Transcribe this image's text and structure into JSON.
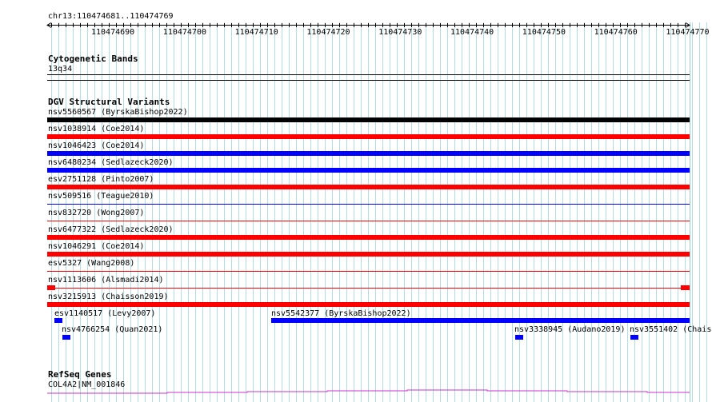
{
  "ruler": {
    "location": "chr13:110474681..110474769",
    "ticks": [
      "110474690",
      "110474700",
      "110474710",
      "110474720",
      "110474730",
      "110474740",
      "110474750",
      "110474760",
      "110474770"
    ]
  },
  "cytobands": {
    "title": "Cytogenetic Bands",
    "band": "13q34"
  },
  "dgv": {
    "title": "DGV Structural Variants",
    "colors": {
      "black": "#000000",
      "red": "#ff0000",
      "blue": "#0000ff"
    },
    "rows": [
      {
        "label": "nsv5560567 (ByrskaBishop2022)",
        "color": "black",
        "style": "full"
      },
      {
        "label": "nsv1038914 (Coe2014)",
        "color": "red",
        "style": "full"
      },
      {
        "label": "nsv1046423 (Coe2014)",
        "color": "blue",
        "style": "full"
      },
      {
        "label": "nsv6480234 (Sedlazeck2020)",
        "color": "blue",
        "style": "full"
      },
      {
        "label": "esv2751128 (Pinto2007)",
        "color": "red",
        "style": "full"
      },
      {
        "label": "nsv509516 (Teague2010)",
        "color": "blue",
        "style": "thin"
      },
      {
        "label": "nsv832720 (Wong2007)",
        "color": "red",
        "style": "thin"
      },
      {
        "label": "nsv6477322 (Sedlazeck2020)",
        "color": "red",
        "style": "full"
      },
      {
        "label": "nsv1046291 (Coe2014)",
        "color": "red",
        "style": "full"
      },
      {
        "label": "esv5327 (Wang2008)",
        "color": "red",
        "style": "thin"
      },
      {
        "label": "nsv1113606 (Alsmadi2014)",
        "color": "red",
        "style": "split"
      },
      {
        "label": "nsv3215913 (Chaisson2019)",
        "color": "red",
        "style": "full"
      }
    ],
    "packed": [
      {
        "label": "esv1140517 (Levy2007)",
        "color": "blue"
      },
      {
        "label": "nsv5542377 (ByrskaBishop2022)",
        "color": "blue"
      },
      {
        "label": "nsv4766254 (Quan2021)",
        "color": "blue"
      },
      {
        "label": "nsv3338945 (Audano2019)",
        "color": "blue"
      },
      {
        "label": "nsv3551402 (Chais",
        "color": "blue"
      }
    ]
  },
  "refseq": {
    "title": "RefSeq Genes",
    "gene": "COL4A2|NM_001846",
    "color": "#cc33cc"
  }
}
